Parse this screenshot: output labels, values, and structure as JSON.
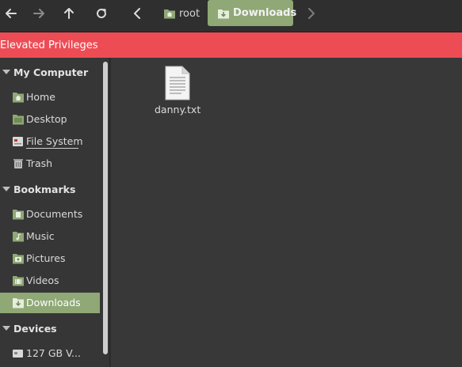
{
  "toolbar": {
    "back_icon": "arrow-left-icon",
    "forward_icon": "arrow-right-icon",
    "up_icon": "arrow-up-icon",
    "reload_icon": "reload-icon",
    "breadcrumb_prev_icon": "chevron-left-icon",
    "breadcrumb_next_icon": "chevron-right-icon",
    "breadcrumbs": [
      {
        "label": "root",
        "icon": "home-folder-icon"
      },
      {
        "label": "Downloads",
        "icon": "downloads-folder-icon",
        "active": true
      }
    ]
  },
  "banner": {
    "text": "Elevated Privileges",
    "color": "#ed4c55"
  },
  "sidebar": {
    "sections": [
      {
        "title": "My Computer",
        "items": [
          {
            "label": "Home",
            "icon": "home-folder-icon"
          },
          {
            "label": "Desktop",
            "icon": "desktop-icon"
          },
          {
            "label": "File System",
            "icon": "drive-icon"
          },
          {
            "label": "Trash",
            "icon": "trash-icon"
          }
        ]
      },
      {
        "title": "Bookmarks",
        "items": [
          {
            "label": "Documents",
            "icon": "documents-folder-icon"
          },
          {
            "label": "Music",
            "icon": "music-folder-icon"
          },
          {
            "label": "Pictures",
            "icon": "pictures-folder-icon"
          },
          {
            "label": "Videos",
            "icon": "videos-folder-icon"
          },
          {
            "label": "Downloads",
            "icon": "downloads-folder-icon",
            "selected": true
          }
        ]
      },
      {
        "title": "Devices",
        "items": [
          {
            "label": "127 GB V...",
            "icon": "drive-icon"
          }
        ]
      }
    ]
  },
  "main": {
    "files": [
      {
        "name": "danny.txt",
        "icon": "text-file-icon"
      }
    ]
  },
  "colors": {
    "accent": "#8fa876",
    "banner": "#ed4c55",
    "background": "#383838",
    "sidebar": "#363636"
  }
}
